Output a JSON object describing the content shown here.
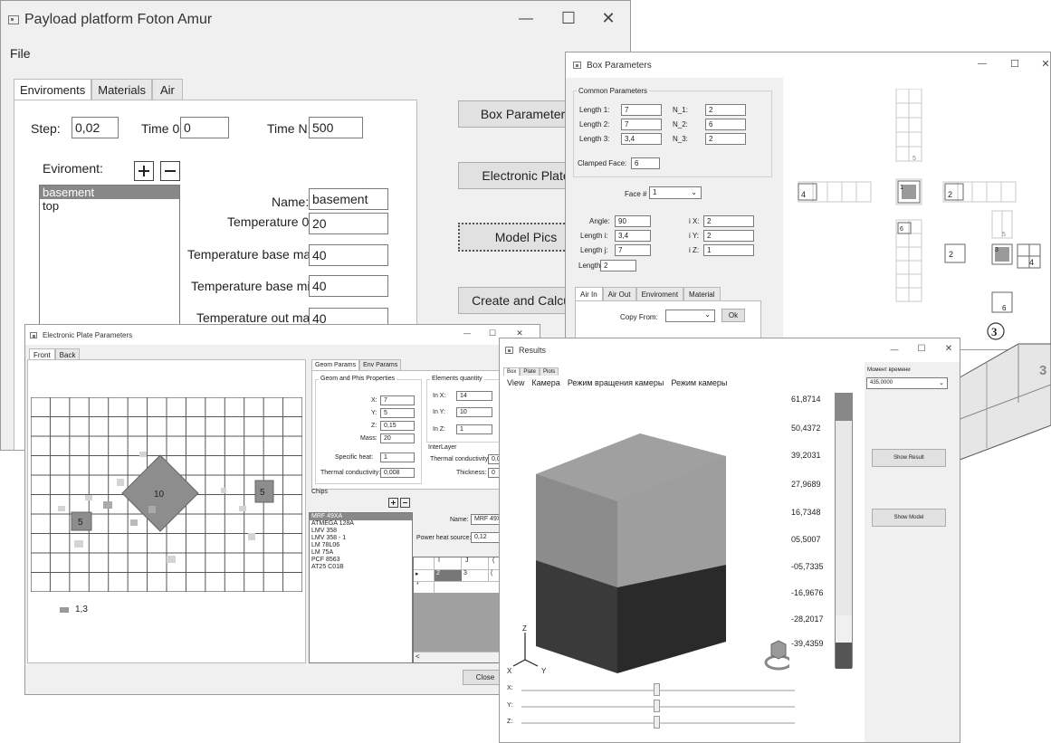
{
  "main": {
    "title": "Payload platform Foton Amur",
    "minimize": "—",
    "maximize": "☐",
    "close": "✕",
    "menu_file": "File",
    "tabs": [
      "Enviroments",
      "Materials",
      "Air"
    ],
    "step_label": "Step:",
    "step_value": "0,02",
    "time0_label": "Time 0:",
    "time0_value": "0",
    "timen_label": "Time N:",
    "timen_value": "500",
    "env_label": "Eviroment:",
    "env_items": [
      "basement",
      "top"
    ],
    "name_label": "Name:",
    "name_value": "basement",
    "temp0_label": "Temperature 0:",
    "temp0_value": "20",
    "tbmax_label": "Temperature base max:",
    "tbmax_value": "40",
    "tbmin_label": "Temperature base min:",
    "tbmin_value": "40",
    "tomax_label": "Temperature out max:",
    "tomax_value": "40",
    "btn_box": "Box Parameters",
    "btn_plate": "Electronic Plate",
    "btn_model": "Model Pics",
    "btn_calc": "Create and Calcula"
  },
  "box": {
    "title": "Box Parameters",
    "minimize": "—",
    "maximize": "☐",
    "close": "✕",
    "common_label": "Common Parameters",
    "length1_label": "Length 1:",
    "length1_value": "7",
    "length2_label": "Length 2:",
    "length2_value": "7",
    "length3_label": "Length 3:",
    "length3_value": "3,4",
    "n1_label": "N_1:",
    "n1_value": "2",
    "n2_label": "N_2:",
    "n2_value": "6",
    "n3_label": "N_3:",
    "n3_value": "2",
    "clamped_label": "Clamped Face:",
    "clamped_value": "6",
    "face_label": "Face #",
    "face_value": "1",
    "angle_label": "Angle:",
    "angle_value": "90",
    "lengthi_label": "Length i:",
    "lengthi_value": "3,4",
    "lengthj_label": "Length j:",
    "lengthj_value": "7",
    "lengthk_label": "Length k:",
    "lengthk_value": "2",
    "ix_label": "i X:",
    "ix_value": "2",
    "iy_label": "i Y:",
    "iy_value": "2",
    "iz_label": "i Z:",
    "iz_value": "1",
    "tabs": [
      "Air In",
      "Air Out",
      "Enviroment",
      "Material"
    ],
    "copy_label": "Copy From:",
    "ok_label": "Ok",
    "faces": [
      "4",
      "1",
      "2",
      "5",
      "6",
      "2",
      "3",
      "4",
      "5",
      "6"
    ],
    "circled": "3",
    "face3d": "3"
  },
  "plate": {
    "title": "Electronic Plate Parameters",
    "minimize": "—",
    "maximize": "☐",
    "close": "✕",
    "tabs": [
      "Front",
      "Back"
    ],
    "legend_value": "1,3",
    "chip_labels": [
      "10",
      "5",
      "5"
    ],
    "subtabs": [
      "Geom Params",
      "Env Params"
    ],
    "geom_group": "Geom and Phis Properties",
    "x_label": "X:",
    "x_value": "7",
    "y_label": "Y:",
    "y_value": "5",
    "z_label": "Z:",
    "z_value": "0,15",
    "mass_label": "Mass:",
    "mass_value": "20",
    "spec_label": "Specific heat:",
    "spec_value": "1",
    "therm_label": "Thermal conductivity:",
    "therm_value": "0,008",
    "elem_group": "Elements quantity",
    "inx_label": "In X:",
    "inx_value": "14",
    "iny_label": "In Y:",
    "iny_value": "10",
    "inz_label": "In Z:",
    "inz_value": "1",
    "inter_label": "InterLayer",
    "itherm_label": "Thermal conductivity:",
    "itherm_value": "0,0",
    "thick_label": "Thickness:",
    "thick_value": "0",
    "chips_label": "Chips",
    "chips": [
      "MRF 49XA",
      "ATMEGA 128A",
      "LMV 358",
      "LMV 358 - 1",
      "LM 78L06",
      "LM 75A",
      "PCF 8563",
      "AT25 C01B"
    ],
    "chipname_label": "Name:",
    "chipname_value": "MRF 49X",
    "power_label": "Power heat source:",
    "power_value": "0,12",
    "grid_headers": [
      "I",
      "J",
      "("
    ],
    "grid_row": [
      "2",
      "3",
      "("
    ],
    "row_marker": "▸",
    "new_marker": "*",
    "scroll_left": "<",
    "close_btn": "Close"
  },
  "results": {
    "title": "Results",
    "minimize": "—",
    "maximize": "☐",
    "close": "✕",
    "tabs": [
      "Box",
      "Plate",
      "Plots"
    ],
    "menu": [
      "View",
      "Камера",
      "Режим вращения камеры",
      "Режим камеры"
    ],
    "scale": [
      "61,8714",
      "50,4372",
      "39,2031",
      "27,9689",
      "16,7348",
      "05,5007",
      "-05,7335",
      "-16,9676",
      "-28,2017",
      "-39,4359"
    ],
    "time_label": "Момент времени",
    "time_value": "435,0000",
    "show_result": "Show Result",
    "show_model": "Show Model",
    "axis_z": "Z",
    "axis_x": "X",
    "axis_y": "Y",
    "slider_x": "X:",
    "slider_y": "Y:",
    "slider_z": "Z:"
  }
}
